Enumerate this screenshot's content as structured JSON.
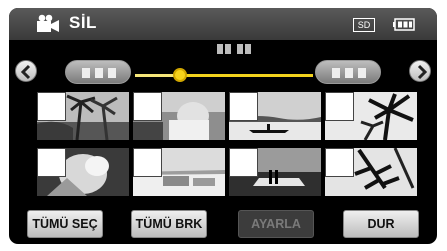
{
  "header": {
    "title": "SİL",
    "storage_badge": "SD",
    "mode_icon": "video-camera-icon",
    "battery_icon": "battery-icon"
  },
  "navigation": {
    "prev_icon": "chevron-left-icon",
    "next_icon": "chevron-right-icon",
    "slider_position": 0.25,
    "accent_color": "#f2d21d"
  },
  "thumbnails": [
    {
      "scene": "palm-trees",
      "checked": false
    },
    {
      "scene": "person-reading",
      "checked": false
    },
    {
      "scene": "canoe-on-water",
      "checked": false
    },
    {
      "scene": "palm-silhouette",
      "checked": false
    },
    {
      "scene": "people-hugging",
      "checked": false
    },
    {
      "scene": "beach-chairs",
      "checked": false
    },
    {
      "scene": "couple-at-sunset",
      "checked": false
    },
    {
      "scene": "palm-fronds",
      "checked": false
    }
  ],
  "buttons": {
    "select_all": "TÜMÜ SEÇ",
    "deselect_all": "TÜMÜ BRK",
    "set": "AYARLA",
    "stop": "DUR"
  }
}
